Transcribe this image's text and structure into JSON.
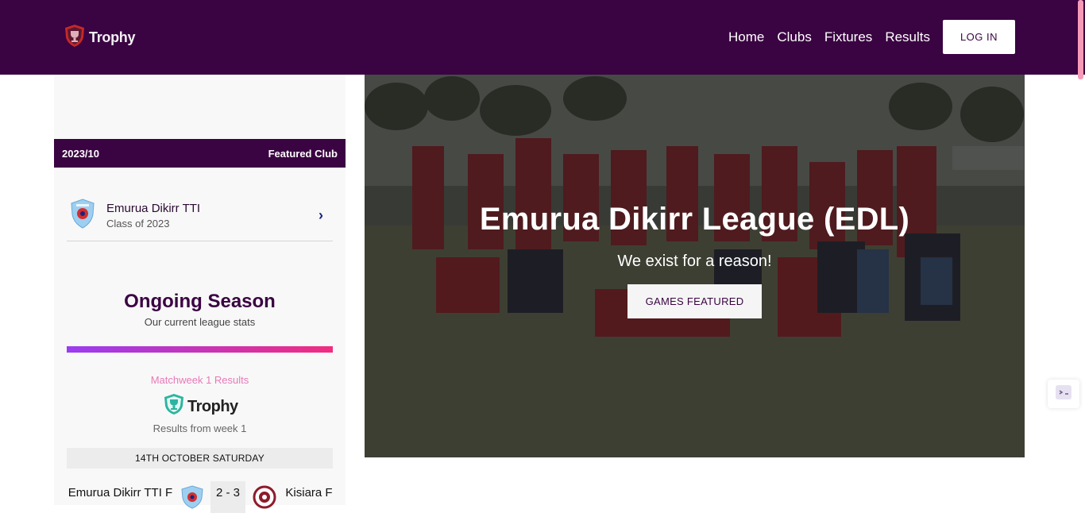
{
  "header": {
    "brand": "Trophy",
    "nav": [
      "Home",
      "Clubs",
      "Fixtures",
      "Results"
    ],
    "login_label": "LOG IN",
    "bg_color": "#3a0342"
  },
  "sidebar": {
    "season_label": "2023/10",
    "featured_label": "Featured Club",
    "club": {
      "name": "Emurua Dikirr TTI",
      "subtitle": "Class of 2023"
    },
    "ongoing_title": "Ongoing Season",
    "ongoing_sub": "Our current league stats",
    "matchweek_label": "Matchweek 1 Results",
    "widget_brand": "Trophy",
    "results_from": "Results from week 1",
    "date_label": "14TH OCTOBER SATURDAY",
    "match": {
      "home": "Emurua Dikirr TTI F",
      "score": "2 - 3",
      "away": "Kisiara F"
    }
  },
  "hero": {
    "title": "Emurua Dikirr League (EDL)",
    "subtitle": "We exist for a reason!",
    "button_label": "GAMES FEATURED"
  },
  "icons": {
    "brand_logo": "trophy-shield-icon",
    "club_crest": "club-crest-icon",
    "chevron": "chevron-right-icon",
    "away_crest": "away-crest-icon",
    "chat_widget": "chat-widget-icon"
  },
  "colors": {
    "accent": "#3a0342",
    "gradient_start": "#9b3cf0",
    "gradient_end": "#f02d80",
    "matchweek": "#e879b8"
  }
}
